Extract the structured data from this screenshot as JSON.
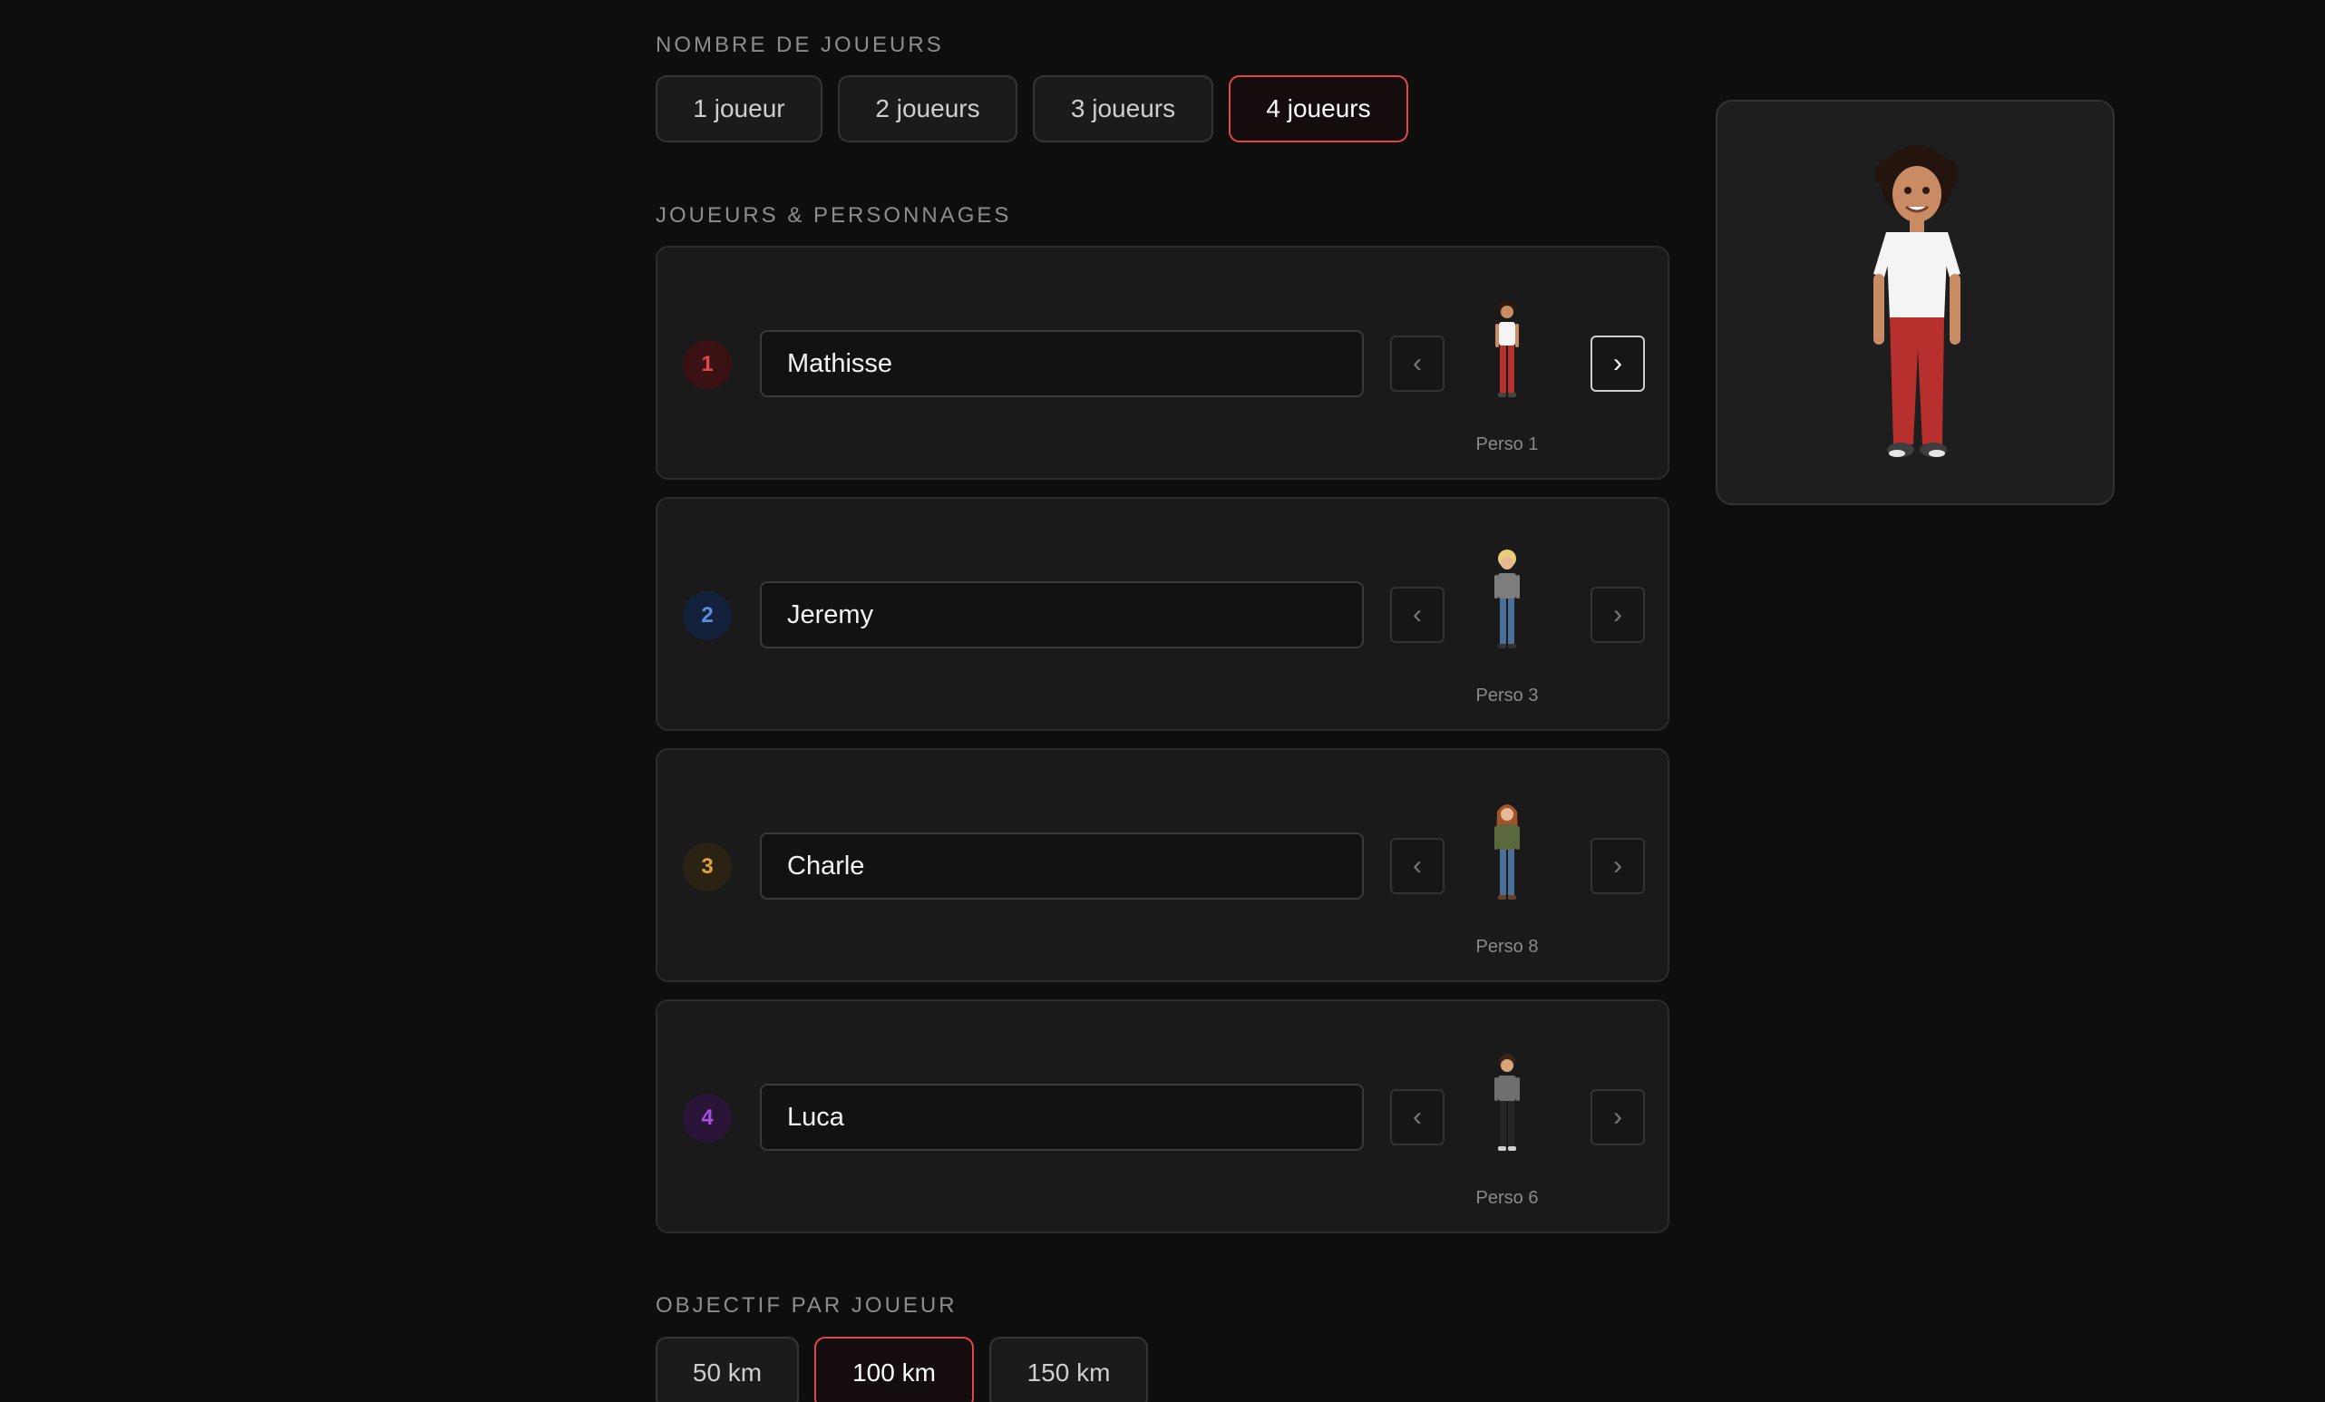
{
  "players_section": {
    "label": "NOMBRE DE JOUEURS",
    "options": [
      "1 joueur",
      "2 joueurs",
      "3 joueurs",
      "4 joueurs"
    ],
    "selected": "4 joueurs"
  },
  "characters_section": {
    "label": "JOUEURS & PERSONNAGES",
    "players": [
      {
        "number": "1",
        "name": "Mathisse",
        "character": "Perso 1",
        "badge_color": "#e0464c",
        "badge_bg": "#3a1214"
      },
      {
        "number": "2",
        "name": "Jeremy",
        "character": "Perso 3",
        "badge_color": "#5b8fe0",
        "badge_bg": "#14213a"
      },
      {
        "number": "3",
        "name": "Charle",
        "character": "Perso 8",
        "badge_color": "#e0a13a",
        "badge_bg": "#2a2212"
      },
      {
        "number": "4",
        "name": "Luca",
        "character": "Perso 6",
        "badge_color": "#a84fe0",
        "badge_bg": "#2a1438"
      }
    ],
    "prev_symbol": "‹",
    "next_symbol": "›"
  },
  "objective_section": {
    "label": "OBJECTIF PAR JOUEUR",
    "options": [
      "50 km",
      "100 km",
      "150 km"
    ],
    "selected": "100 km"
  },
  "colors": {
    "accent": "#e0464c",
    "background": "#0e0e0e",
    "card": "#1a1a1a"
  }
}
